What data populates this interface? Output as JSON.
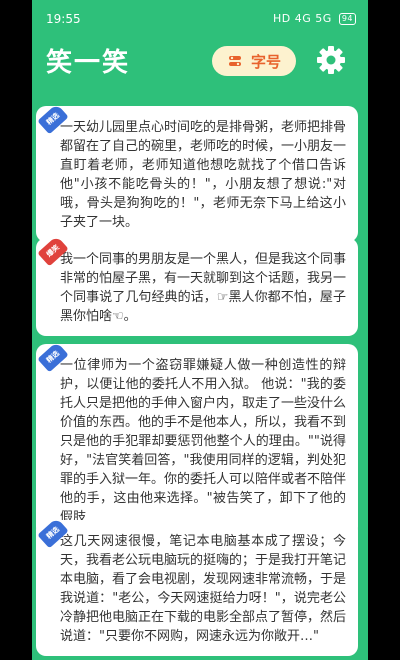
{
  "status": {
    "time": "19:55",
    "signal_text": "HD 4G 5G",
    "battery": "94"
  },
  "header": {
    "title": "笑一笑",
    "font_button_label": "字号"
  },
  "colors": {
    "brand_green": "#2ec07a",
    "badge_blue": "#3a6fd8",
    "badge_red": "#e0423c",
    "font_button_bg": "#fdf2cf",
    "font_button_text": "#e8622c"
  },
  "jokes": [
    {
      "badge": "精选",
      "badge_color": "#3a6fd8",
      "text": "一天幼儿园里点心时间吃的是排骨粥，老师把排骨都留在了自己的碗里，老师吃的时候，一小朋友一直盯着老师，老师知道他想吃就找了个借口告诉他\"小孩不能吃骨头的！\"，小朋友想了想说:\"对哦，骨头是狗狗吃的！\"，老师无奈下马上给这小子夹了一块。"
    },
    {
      "badge": "爆笑",
      "badge_color": "#e0423c",
      "text": "我一个同事的男朋友是一个黑人，但是我这个同事非常的怕屋子黑，有一天就聊到这个话题，我另一个同事说了几句经典的话，☞黑人你都不怕，屋子黑你怕啥☜。"
    },
    {
      "badge": "精选",
      "badge_color": "#3a6fd8",
      "text": "一位律师为一个盗窃罪嫌疑人做一种创造性的辩护，以便让他的委托人不用入狱。 他说：\"我的委托人只是把他的手伸入窗户内，取走了一些没什么价值的东西。他的手不是他本人，所以，我看不到只是他的手犯罪却要惩罚他整个人的理由。\"\"说得好，\"法官笑着回答，\"我使用同样的逻辑，判处犯罪的手入狱一年。你的委托人可以陪伴或者不陪伴他的手，这由他来选择。\"被告笑了，卸下了他的假肢"
    },
    {
      "badge": "精选",
      "badge_color": "#3a6fd8",
      "text": "这几天网速很慢，笔记本电脑基本成了摆设；今天，我看老公玩电脑玩的挺嗨的；于是我打开笔记本电脑，看了会电视剧，发现网速非常流畅，于是我说道：\"老公，今天网速挺给力呀！\"，说完老公冷静把他电脑正在下载的电影全部点了暂停，然后说道：\"只要你不网购，网速永远为你敞开…\""
    }
  ]
}
